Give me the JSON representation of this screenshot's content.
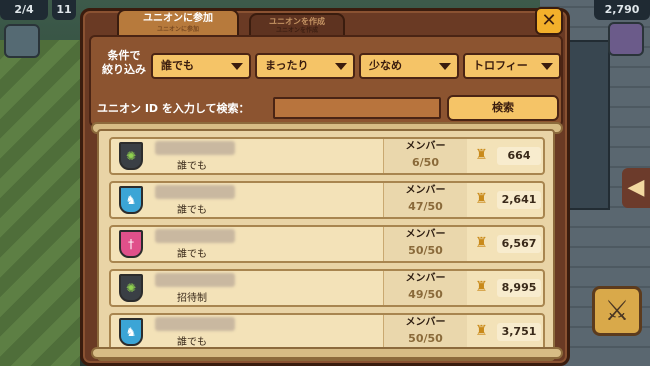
{
  "hud": {
    "left_counter": "2/4",
    "left_counter2": "11",
    "right_counter": "2,790"
  },
  "dialog": {
    "tabs": [
      {
        "label": "ユニオンに参加",
        "sublabel": "ユニオンに参加",
        "active": true
      },
      {
        "label": "ユニオンを作成",
        "sublabel": "ユニオンを作成",
        "active": false
      }
    ],
    "close_icon": "close-x-icon"
  },
  "filters": {
    "label_line1": "条件で",
    "label_line2": "絞り込み",
    "dropdowns": [
      "誰でも",
      "まったり",
      "少なめ",
      "トロフィー"
    ]
  },
  "search": {
    "label": "ユニオン ID を入力して検索：",
    "value": "",
    "button_label": "検索"
  },
  "unions": [
    {
      "emblem": "green-skull-emblem",
      "emblem_color": "#3a3f45",
      "policy": "誰でも",
      "member_label": "メンバー",
      "members": "6/50",
      "trophies": "664"
    },
    {
      "emblem": "white-unicorn-emblem",
      "emblem_color": "#3ba5d6",
      "policy": "誰でも",
      "member_label": "メンバー",
      "members": "47/50",
      "trophies": "2,641"
    },
    {
      "emblem": "pink-sword-emblem",
      "emblem_color": "#e0508a",
      "policy": "誰でも",
      "member_label": "メンバー",
      "members": "50/50",
      "trophies": "6,567"
    },
    {
      "emblem": "green-skull-emblem",
      "emblem_color": "#3a3f45",
      "policy": "招待制",
      "member_label": "メンバー",
      "members": "49/50",
      "trophies": "8,995"
    },
    {
      "emblem": "white-unicorn-emblem",
      "emblem_color": "#3ba5d6",
      "policy": "誰でも",
      "member_label": "メンバー",
      "members": "50/50",
      "trophies": "3,751"
    }
  ]
}
